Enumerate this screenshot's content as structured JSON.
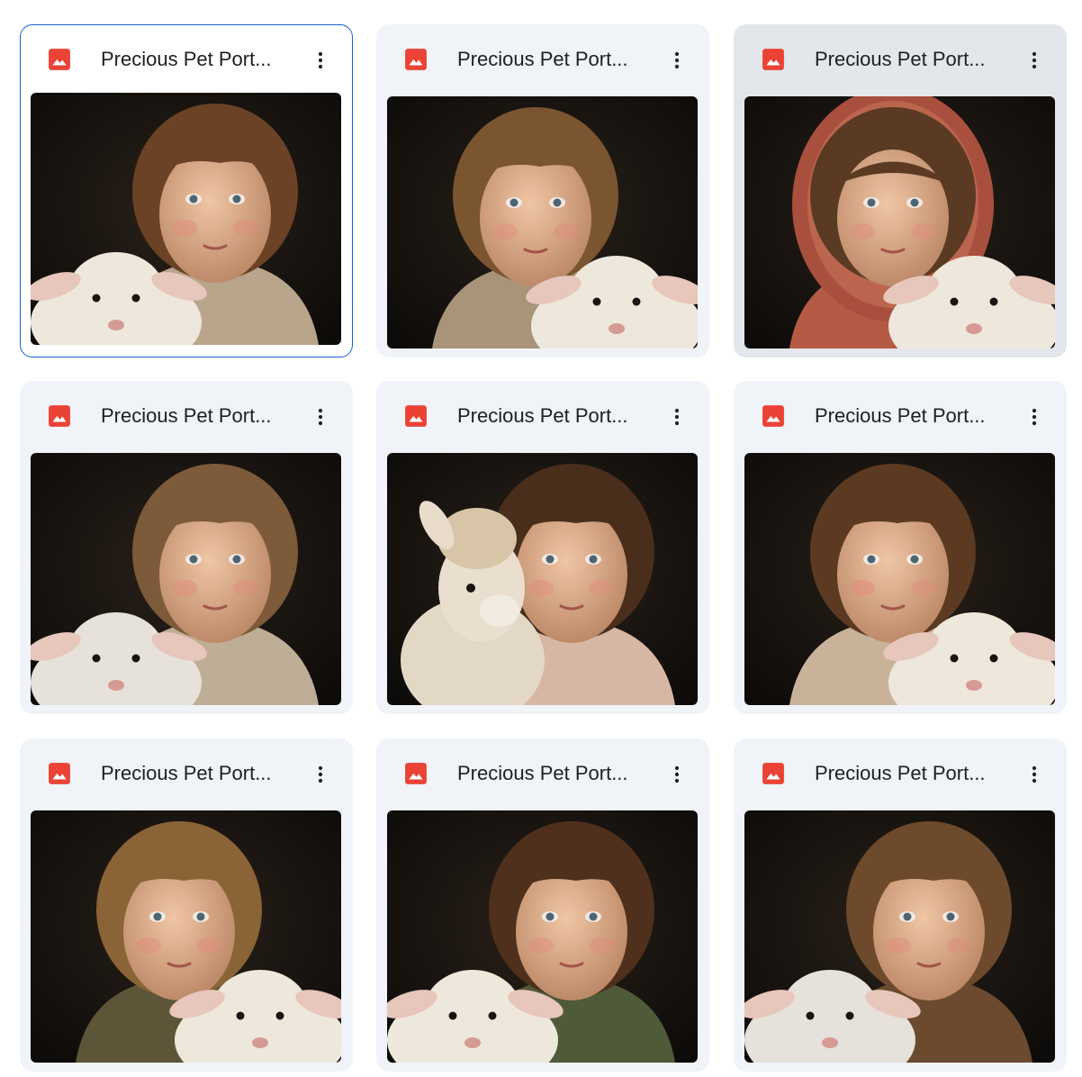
{
  "files": [
    {
      "name": "Precious Pet Portraits",
      "display": "Precious Pet Port...",
      "type_icon": "image-file-icon",
      "state": "selected",
      "hair": "#6b4226",
      "hood": false,
      "animal": "lamb",
      "animal_side": "left",
      "shirt": "#b9a48c"
    },
    {
      "name": "Precious Pet Portraits",
      "display": "Precious Pet Port...",
      "type_icon": "image-file-icon",
      "state": "normal",
      "hair": "#7a5530",
      "hood": false,
      "animal": "lamb",
      "animal_side": "right",
      "shirt": "#a89478"
    },
    {
      "name": "Precious Pet Portraits",
      "display": "Precious Pet Port...",
      "type_icon": "image-file-icon",
      "state": "hovered",
      "hair": "#5a3a22",
      "hood": true,
      "animal": "lamb",
      "animal_side": "right",
      "shirt": "#b55a44"
    },
    {
      "name": "Precious Pet Portraits",
      "display": "Precious Pet Port...",
      "type_icon": "image-file-icon",
      "state": "normal",
      "hair": "#7d5a3a",
      "hood": false,
      "animal": "goat",
      "animal_side": "left",
      "shirt": "#bfae96"
    },
    {
      "name": "Precious Pet Portraits",
      "display": "Precious Pet Port...",
      "type_icon": "image-file-icon",
      "state": "normal",
      "hair": "#4a2e1c",
      "hood": false,
      "animal": "alpaca",
      "animal_side": "left",
      "shirt": "#d6b7a4"
    },
    {
      "name": "Precious Pet Portraits",
      "display": "Precious Pet Port...",
      "type_icon": "image-file-icon",
      "state": "normal",
      "hair": "#5c3a22",
      "hood": false,
      "animal": "lamb",
      "animal_side": "right",
      "shirt": "#c9b29a"
    },
    {
      "name": "Precious Pet Portraits",
      "display": "Precious Pet Port...",
      "type_icon": "image-file-icon",
      "state": "normal",
      "hair": "#8a6336",
      "hood": false,
      "animal": "lamb",
      "animal_side": "right",
      "shirt": "#5d5538"
    },
    {
      "name": "Precious Pet Portraits",
      "display": "Precious Pet Port...",
      "type_icon": "image-file-icon",
      "state": "normal",
      "hair": "#4e301c",
      "hood": false,
      "animal": "lamb",
      "animal_side": "left",
      "shirt": "#4f5a38"
    },
    {
      "name": "Precious Pet Portraits",
      "display": "Precious Pet Port...",
      "type_icon": "image-file-icon",
      "state": "normal",
      "hair": "#6e4a2c",
      "hood": false,
      "animal": "goat",
      "animal_side": "left",
      "shirt": "#6b4a30"
    }
  ],
  "more_icon": "more-vert-icon",
  "colors": {
    "card_bg": "#f0f3f8",
    "card_hover_bg": "#e3e6ea",
    "selected_border": "#1a62d2",
    "image_icon": "#ea4335",
    "title_text": "#1f1f1f"
  }
}
